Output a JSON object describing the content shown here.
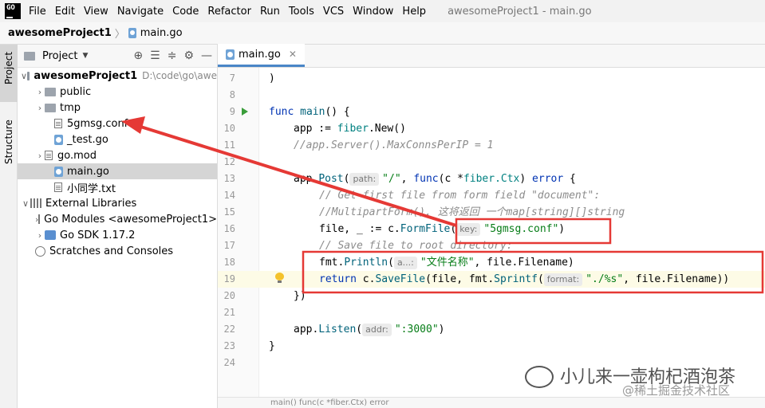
{
  "menubar": {
    "logo": "GO",
    "items": [
      "File",
      "Edit",
      "View",
      "Navigate",
      "Code",
      "Refactor",
      "Run",
      "Tools",
      "VCS",
      "Window",
      "Help"
    ],
    "title": "awesomeProject1 - main.go"
  },
  "breadcrumb": {
    "project": "awesomeProject1",
    "file": "main.go"
  },
  "toolstrip": {
    "project_tab": "Project",
    "structure_tab": "Structure"
  },
  "project_panel": {
    "title": "Project",
    "tree": [
      {
        "label": "awesomeProject1",
        "path": "D:\\code\\go\\awe"
      },
      {
        "label": "public"
      },
      {
        "label": "tmp"
      },
      {
        "label": "5gmsg.conf"
      },
      {
        "label": "_test.go"
      },
      {
        "label": "go.mod"
      },
      {
        "label": "main.go"
      },
      {
        "label": "小同学.txt"
      },
      {
        "label": "External Libraries"
      },
      {
        "label": "Go Modules <awesomeProject1>"
      },
      {
        "label": "Go SDK 1.17.2"
      },
      {
        "label": "Scratches and Consoles"
      }
    ]
  },
  "editor": {
    "tab_label": "main.go",
    "lines": [
      {
        "n": "7",
        "t": ")"
      },
      {
        "n": "8",
        "t": ""
      },
      {
        "n": "9",
        "kw": "func",
        "fn": "main",
        "rest": "() {"
      },
      {
        "n": "10",
        "a": "app := ",
        "t1": "fiber",
        "t2": ".New()"
      },
      {
        "n": "11",
        "cmt": "//app.Server().MaxConnsPerIP = 1"
      },
      {
        "n": "12",
        "t": ""
      },
      {
        "n": "13",
        "a": "app.",
        "fn": "Post",
        "b": "(",
        "hint": "path:",
        "s": "\"/\"",
        "c": ", ",
        "kw": "func",
        "d": "(c *",
        "ty": "fiber.Ctx",
        "e": ") ",
        "kw2": "error",
        "f": " {"
      },
      {
        "n": "14",
        "cmt": "// Get first file from form field \"document\":"
      },
      {
        "n": "15",
        "cmt": "//MultipartForm(). 这将返回 一个map[string][]string"
      },
      {
        "n": "16",
        "a": "file, _ := c.",
        "fn": "FormFile",
        "b": "(",
        "hint": "key:",
        "s": "\"5gmsg.conf\"",
        "c": ")"
      },
      {
        "n": "17",
        "cmt": "// Save file to root directory:"
      },
      {
        "n": "18",
        "a": "fmt.",
        "fn": "Println",
        "b": "(",
        "hint": "a...:",
        "s": "\"文件名称\"",
        "c": ", file.Filename)"
      },
      {
        "n": "19",
        "kw": "return",
        "a": " c.",
        "fn": "SaveFile",
        "b": "(file, fmt.",
        "fn2": "Sprintf",
        "b2": "(",
        "hint": "format:",
        "s": "\"./%s\"",
        "c": ", file.Filename))"
      },
      {
        "n": "20",
        "t": "})"
      },
      {
        "n": "21",
        "t": ""
      },
      {
        "n": "22",
        "a": "app.",
        "fn": "Listen",
        "b": "(",
        "hint": "addr:",
        "s": "\":3000\"",
        "c": ")"
      },
      {
        "n": "23",
        "t": "}"
      },
      {
        "n": "24",
        "t": ""
      }
    ]
  },
  "status": {
    "text": "main()    func(c *fiber.Ctx) error"
  },
  "watermark": {
    "line1": "小儿来一壶枸杞酒泡茶",
    "line2": "@稀土掘金技术社区"
  },
  "colors": {
    "annotation": "#e53935",
    "accent": "#4a86c7"
  }
}
